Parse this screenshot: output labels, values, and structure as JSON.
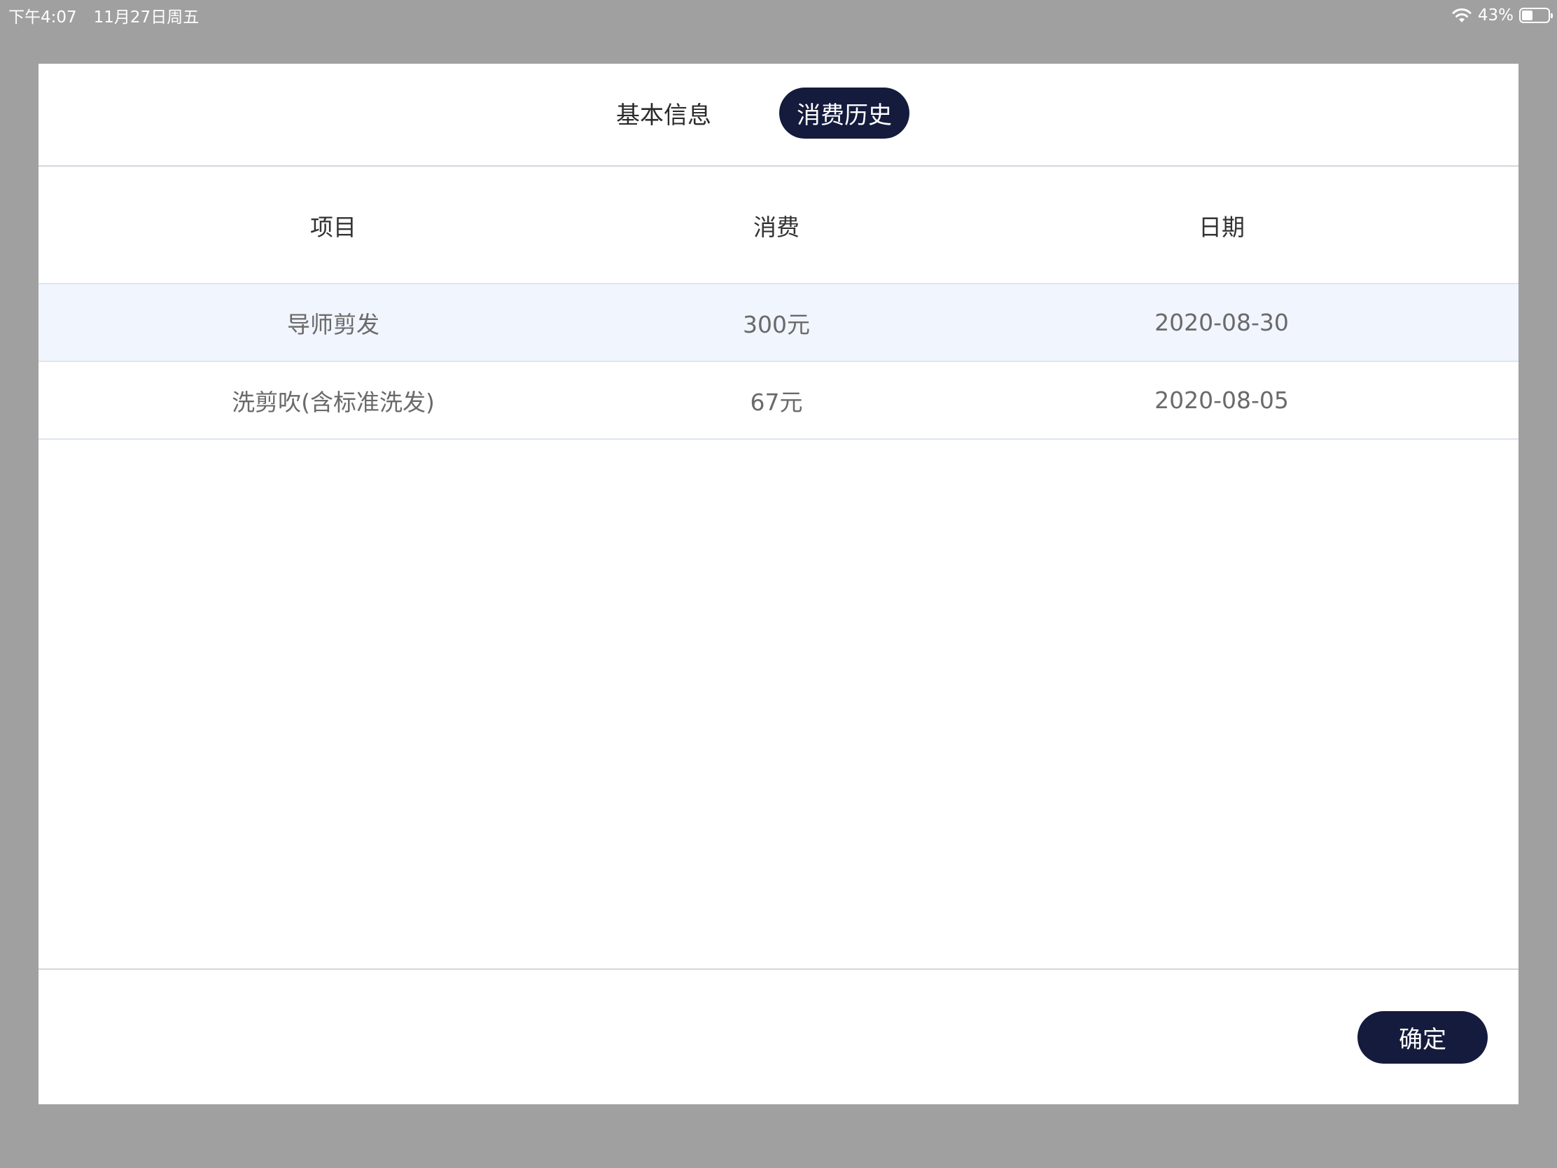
{
  "status_bar": {
    "time": "下午4:07",
    "date": "11月27日周五",
    "battery_percent_text": "43%",
    "battery_level": 0.43,
    "icons": [
      "wifi-icon",
      "battery-icon"
    ]
  },
  "tabs": [
    {
      "label": "基本信息",
      "active": false
    },
    {
      "label": "消费历史",
      "active": true
    }
  ],
  "table": {
    "columns": [
      "项目",
      "消费",
      "日期"
    ],
    "rows": [
      {
        "item": "导师剪发",
        "cost": "300元",
        "date": "2020-08-30",
        "highlighted": true
      },
      {
        "item": "洗剪吹(含标准洗发)",
        "cost": "67元",
        "date": "2020-08-05",
        "highlighted": false
      }
    ]
  },
  "footer": {
    "confirm_label": "确定"
  },
  "colors": {
    "backdrop": "#a0a0a0",
    "accent": "#141b3c",
    "row_highlight": "#f1f5fe",
    "divider": "#dde4f2"
  }
}
